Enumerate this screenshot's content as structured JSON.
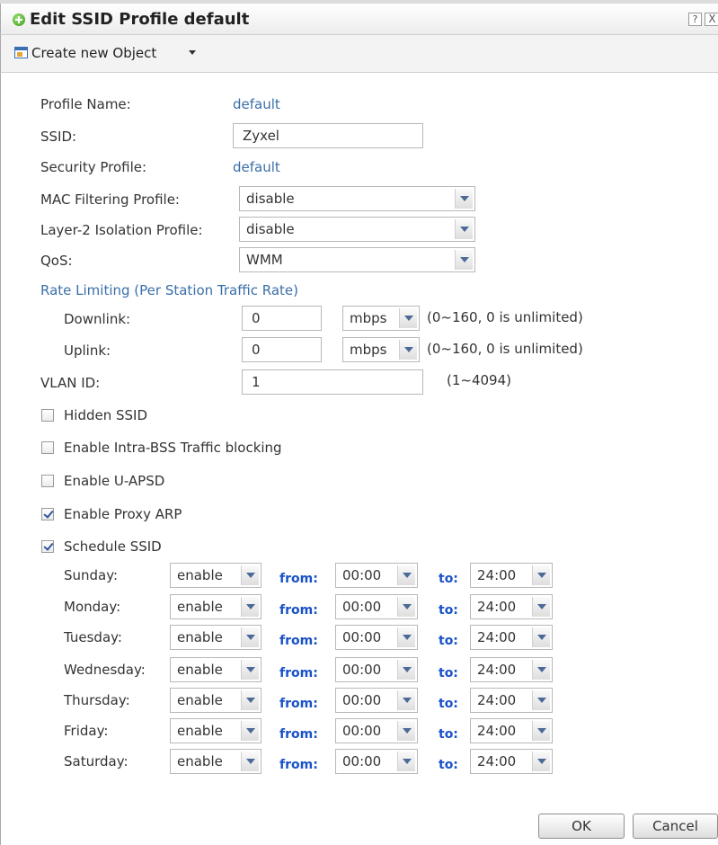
{
  "window": {
    "title": "Edit SSID Profile default",
    "help_label": "?",
    "close_label": "X"
  },
  "toolbar": {
    "create_object_label": "Create new Object"
  },
  "form": {
    "profile_name": {
      "label": "Profile Name:",
      "value": "default"
    },
    "ssid": {
      "label": "SSID:",
      "value": "Zyxel"
    },
    "security_profile": {
      "label": "Security Profile:",
      "value": "default"
    },
    "mac_filtering": {
      "label": "MAC Filtering Profile:",
      "value": "disable"
    },
    "layer2_isolation": {
      "label": "Layer-2 Isolation Profile:",
      "value": "disable"
    },
    "qos": {
      "label": "QoS:",
      "value": "WMM"
    },
    "rate_limiting": {
      "title": "Rate Limiting (Per Station Traffic Rate)",
      "downlink": {
        "label": "Downlink:",
        "value": "0",
        "unit": "mbps",
        "hint": "(0~160, 0 is unlimited)"
      },
      "uplink": {
        "label": "Uplink:",
        "value": "0",
        "unit": "mbps",
        "hint": "(0~160, 0 is unlimited)"
      }
    },
    "vlan_id": {
      "label": "VLAN ID:",
      "value": "1",
      "hint": "(1~4094)"
    },
    "options": [
      {
        "label": "Hidden SSID",
        "checked": false
      },
      {
        "label": "Enable Intra-BSS Traffic blocking",
        "checked": false
      },
      {
        "label": "Enable U-APSD",
        "checked": false
      },
      {
        "label": "Enable Proxy ARP",
        "checked": true
      },
      {
        "label": "Schedule SSID",
        "checked": true
      }
    ]
  },
  "schedule": {
    "from_label": "from:",
    "to_label": "to:",
    "days": [
      {
        "day": "Sunday:",
        "state": "enable",
        "from": "00:00",
        "to": "24:00"
      },
      {
        "day": "Monday:",
        "state": "enable",
        "from": "00:00",
        "to": "24:00"
      },
      {
        "day": "Tuesday:",
        "state": "enable",
        "from": "00:00",
        "to": "24:00"
      },
      {
        "day": "Wednesday:",
        "state": "enable",
        "from": "00:00",
        "to": "24:00"
      },
      {
        "day": "Thursday:",
        "state": "enable",
        "from": "00:00",
        "to": "24:00"
      },
      {
        "day": "Friday:",
        "state": "enable",
        "from": "00:00",
        "to": "24:00"
      },
      {
        "day": "Saturday:",
        "state": "enable",
        "from": "00:00",
        "to": "24:00"
      }
    ]
  },
  "footer": {
    "ok_label": "OK",
    "cancel_label": "Cancel"
  },
  "colors": {
    "link": "#3a6fa8",
    "keyword": "#1a52c8",
    "checkmark": "#2a56a0"
  }
}
